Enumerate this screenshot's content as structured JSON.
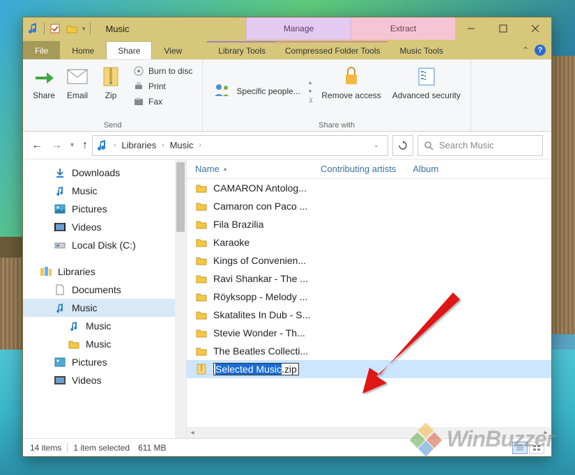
{
  "window": {
    "title": "Music",
    "context_tabs": {
      "manage": "Manage",
      "extract": "Extract"
    }
  },
  "tabs": {
    "file": "File",
    "home": "Home",
    "share": "Share",
    "view": "View",
    "library_tools": "Library Tools",
    "compressed": "Compressed Folder Tools",
    "music_tools": "Music Tools"
  },
  "ribbon": {
    "send": {
      "share": "Share",
      "email": "Email",
      "zip": "Zip",
      "burn": "Burn to disc",
      "print": "Print",
      "fax": "Fax",
      "group_label": "Send"
    },
    "share_with": {
      "specific": "Specific people...",
      "remove": "Remove access",
      "advanced": "Advanced security",
      "group_label": "Share with"
    }
  },
  "breadcrumb": {
    "root": "Libraries",
    "folder": "Music"
  },
  "search": {
    "placeholder": "Search Music"
  },
  "nav": {
    "downloads": "Downloads",
    "music": "Music",
    "pictures": "Pictures",
    "videos": "Videos",
    "localdisk": "Local Disk (C:)",
    "libraries": "Libraries",
    "lib_documents": "Documents",
    "lib_music": "Music",
    "lib_music_sub1": "Music",
    "lib_music_sub2": "Music",
    "lib_pictures": "Pictures",
    "lib_videos": "Videos"
  },
  "columns": {
    "name": "Name",
    "contributing": "Contributing artists",
    "album": "Album"
  },
  "files": [
    "CAMARON Antolog...",
    "Camaron con Paco ...",
    "Fila Brazilia",
    "Karaoke",
    "Kings of Convenien...",
    "Ravi Shankar - The ...",
    "Röyksopp - Melody ...",
    "Skatalites In Dub - S...",
    "Stevie Wonder - Th...",
    "The Beatles Collecti..."
  ],
  "rename": {
    "selected": "Selected Music",
    "suffix": ".zip"
  },
  "status": {
    "count": "14 items",
    "selection": "1 item selected",
    "size": "611 MB"
  },
  "watermark": "WinBuzzer"
}
